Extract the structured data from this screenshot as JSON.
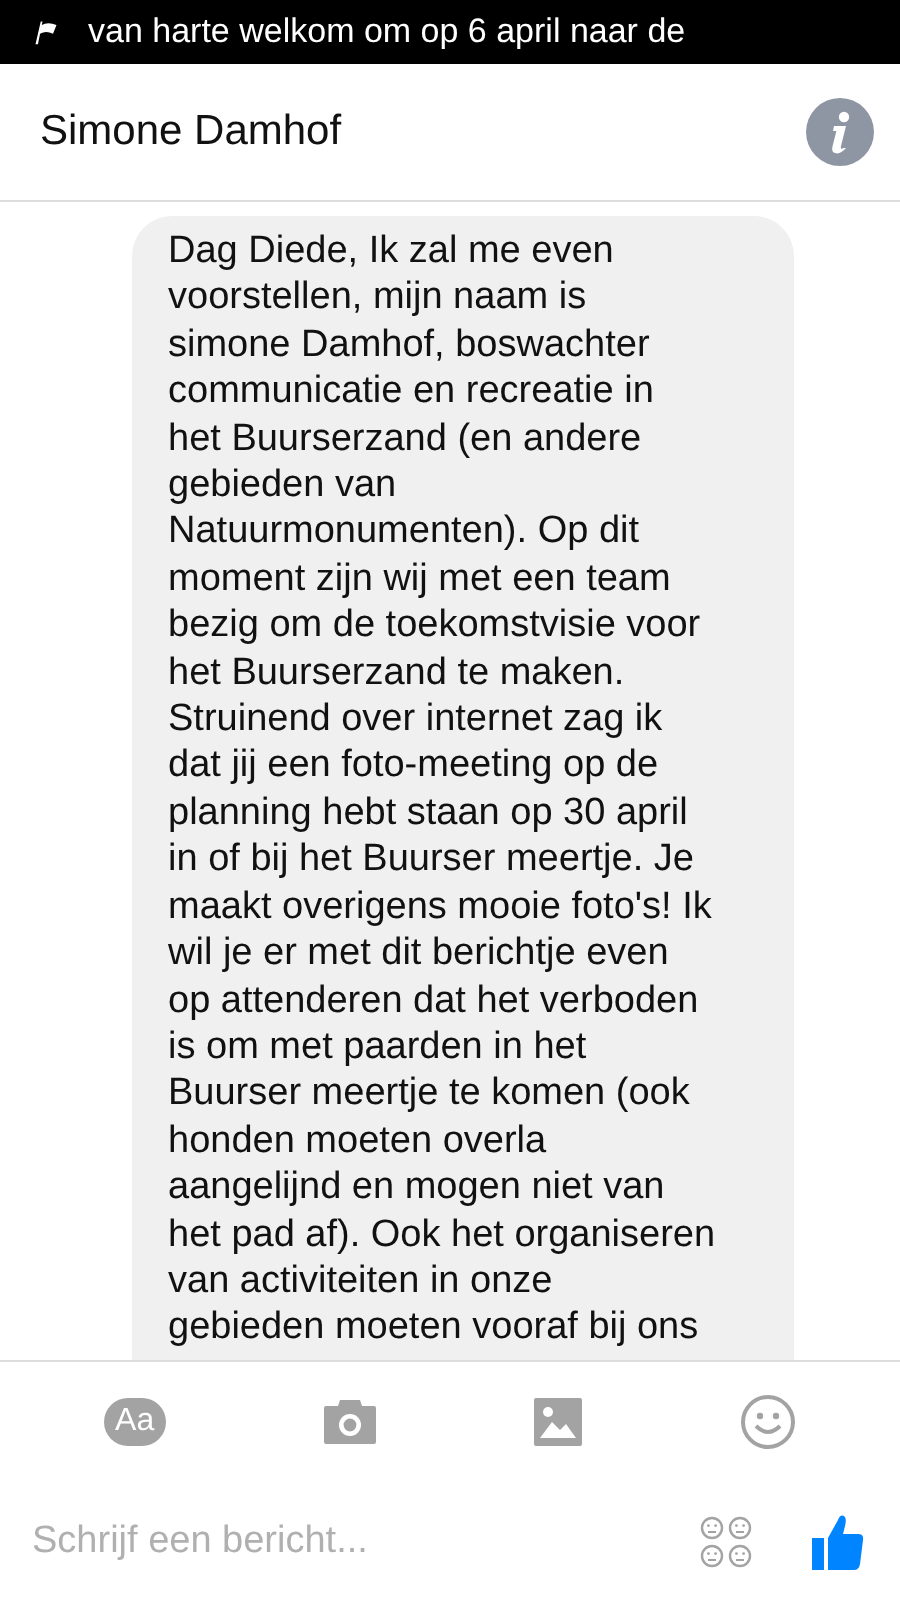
{
  "status_bar": {
    "notification": "van harte welkom om op 6 april naar de"
  },
  "header": {
    "title": "Simone Damhof"
  },
  "messages": [
    {
      "text": "Dag Diede, Ik zal me even\nvoorstellen, mijn naam is\nsimone Damhof, boswachter\ncommunicatie en recreatie in\nhet Buurserzand (en andere\ngebieden van\nNatuurmonumenten). Op dit\nmoment zijn wij met een team\nbezig om de toekomstvisie voor\nhet Buurserzand te maken.\nStruinend over internet zag ik\ndat jij een foto-meeting op de\nplanning hebt staan op 30 april\nin of bij het Buurser meertje. Je\nmaakt overigens mooie foto's! Ik\nwil je er met dit berichtje even\nop attenderen dat het verboden\nis om met paarden in het\nBuurser meertje te komen (ook\nhonden moeten overla\naangelijnd en mogen niet van\nhet pad af). Ook het organiseren\nvan activiteiten in onze\ngebieden moeten vooraf bij ons"
    }
  ],
  "toolbar": {
    "text_button": "Aa"
  },
  "composer": {
    "placeholder": "Schrijf een bericht..."
  }
}
